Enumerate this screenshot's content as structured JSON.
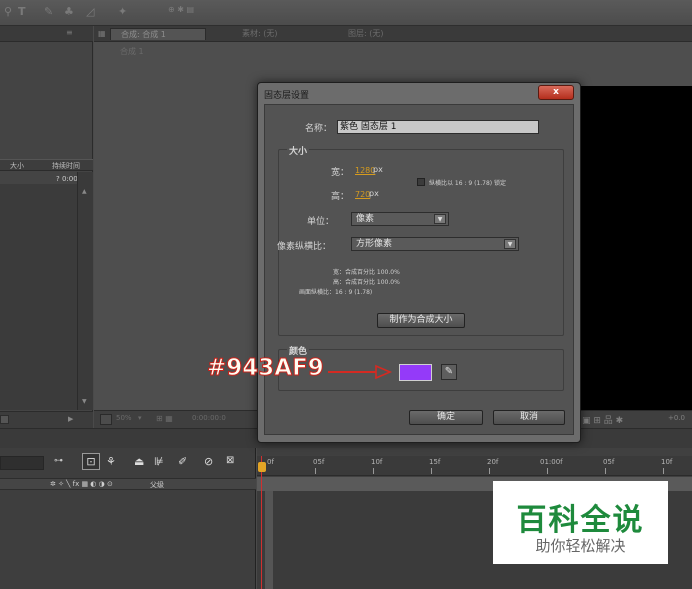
{
  "comp_panel": {
    "tab_active": "合成: 合成 1",
    "tab_footage": "素材: (无)",
    "tab_layer": "图层: (无)",
    "subtab": "合成 1",
    "zoom": "50%",
    "timecode": "0:00:00:0"
  },
  "project_panel": {
    "col_size": "大小",
    "col_duration": "持续时间",
    "row_duration": "? 0:00"
  },
  "dialog": {
    "title": "固态层设置",
    "close_label": "x",
    "name_label": "名称：",
    "name_value": "紫色 固态层 1",
    "size_group": "大小",
    "width_label": "宽：",
    "width_value": "1280",
    "height_label": "高：",
    "height_value": "720",
    "unit_px": "px",
    "lock_aspect": "纵横比以 16 : 9 (1.78) 锁定",
    "units_label": "单位：",
    "units_value": "像素",
    "pixel_aspect_label": "像素纵横比：",
    "pixel_aspect_value": "方形像素",
    "info_width": "宽：合成百分比 100.0%",
    "info_height": "高：合成百分比 100.0%",
    "info_frame": "画面纵横比：16 : 9 (1.78)",
    "make_comp_size": "制作为合成大小",
    "color_group": "颜色",
    "color_hex": "#943AF9",
    "ok": "确定",
    "cancel": "取消"
  },
  "annotation": {
    "text": "#943AF9"
  },
  "timeline": {
    "ticks": [
      "0f",
      "05f",
      "10f",
      "15f",
      "20f",
      "01:00f",
      "05f",
      "10f"
    ],
    "col_header": "父级"
  },
  "watermark": {
    "title": "百科全说",
    "subtitle": "助你轻松解决"
  }
}
